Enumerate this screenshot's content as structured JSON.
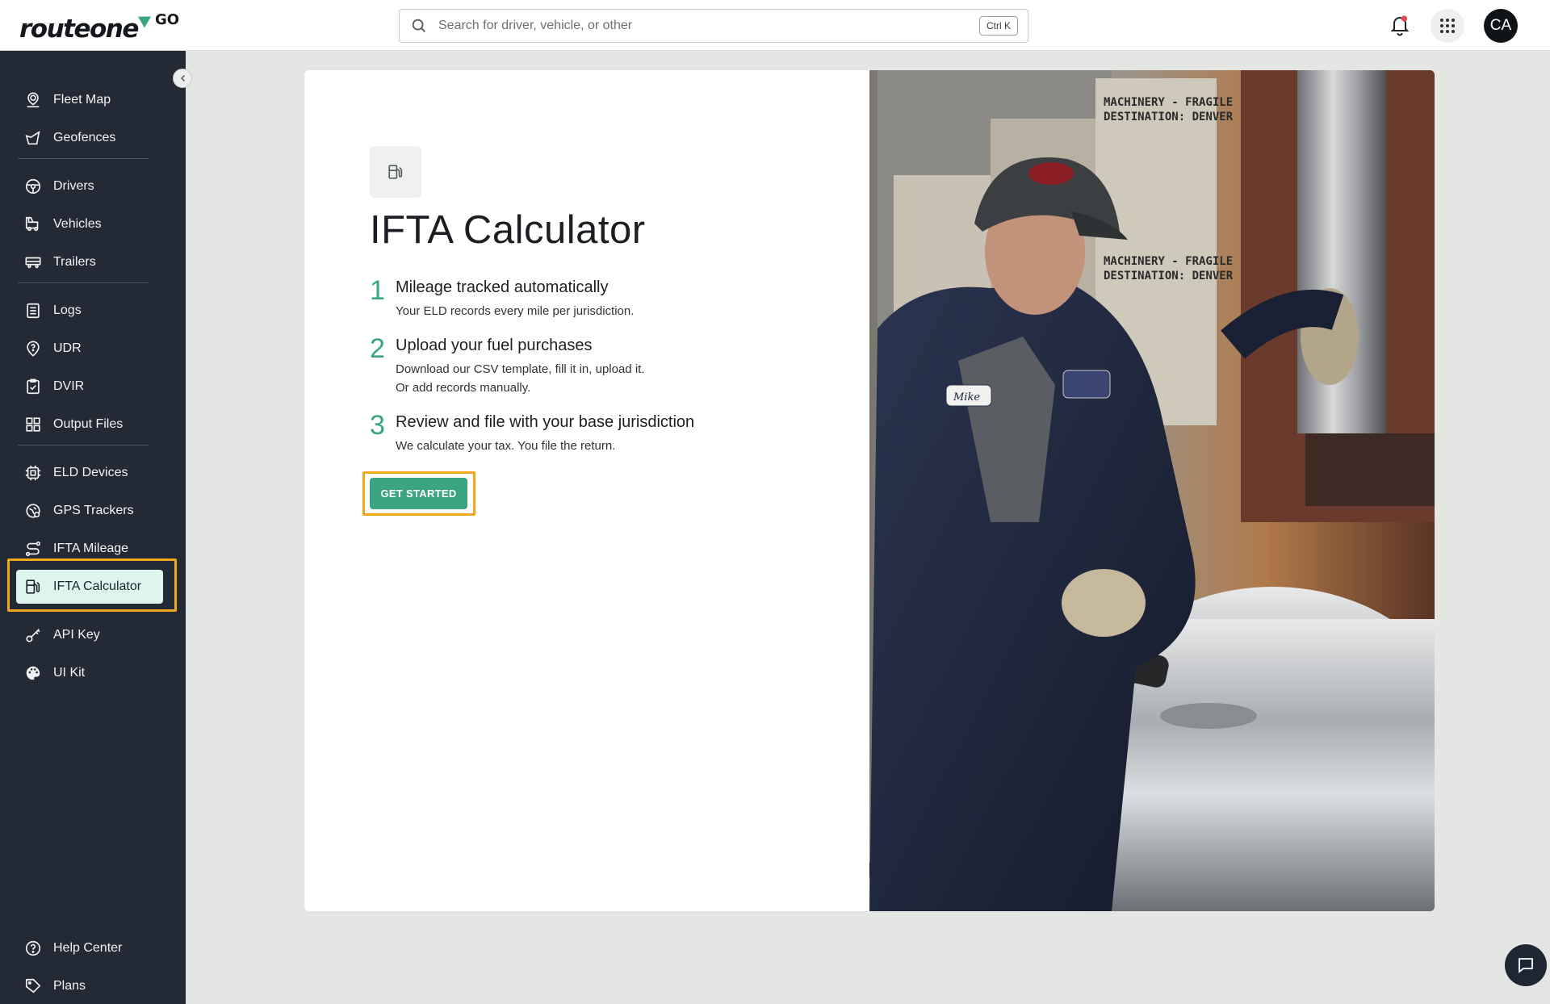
{
  "brand": {
    "name": "routeone",
    "suffix": "GO"
  },
  "search": {
    "placeholder": "Search for driver, vehicle, or other",
    "shortcut": "Ctrl K"
  },
  "user": {
    "initials": "CA"
  },
  "sidebar": {
    "items": [
      {
        "label": "Fleet Map",
        "icon": "map-pin-icon"
      },
      {
        "label": "Geofences",
        "icon": "geofence-icon"
      },
      {
        "label": "Drivers",
        "icon": "steering-wheel-icon"
      },
      {
        "label": "Vehicles",
        "icon": "truck-icon"
      },
      {
        "label": "Trailers",
        "icon": "trailer-icon"
      },
      {
        "label": "Logs",
        "icon": "logs-icon"
      },
      {
        "label": "UDR",
        "icon": "udr-icon"
      },
      {
        "label": "DVIR",
        "icon": "checklist-icon"
      },
      {
        "label": "Output Files",
        "icon": "grid-icon"
      },
      {
        "label": "ELD Devices",
        "icon": "device-icon"
      },
      {
        "label": "GPS Trackers",
        "icon": "gps-icon"
      },
      {
        "label": "IFTA Mileage",
        "icon": "route-icon"
      },
      {
        "label": "IFTA Calculator",
        "icon": "fuel-pump-icon",
        "active": true
      },
      {
        "label": "API Key",
        "icon": "key-icon"
      },
      {
        "label": "UI Kit",
        "icon": "palette-icon"
      }
    ],
    "footer": [
      {
        "label": "Help Center",
        "icon": "help-icon"
      },
      {
        "label": "Plans",
        "icon": "tag-icon"
      }
    ]
  },
  "main": {
    "title": "IFTA Calculator",
    "steps": [
      {
        "num": "1",
        "title": "Mileage tracked automatically",
        "desc": [
          "Your ELD records every mile per jurisdiction."
        ]
      },
      {
        "num": "2",
        "title": "Upload your fuel purchases",
        "desc": [
          "Download our CSV template, fill it in, upload it.",
          "Or add records manually."
        ]
      },
      {
        "num": "3",
        "title": "Review and file with your base jurisdiction",
        "desc": [
          "We calculate your tax. You file the return."
        ]
      }
    ],
    "cta_label": "GET STARTED",
    "photo": {
      "sign_lines": [
        "MACHINERY - FRAGILE",
        "DESTINATION: DENVER"
      ],
      "name_patch": "Mike"
    }
  },
  "colors": {
    "sidebar_bg": "#242a35",
    "accent": "#3aa57f",
    "highlight": "#f4a51c",
    "active_item_bg": "#def5ee",
    "page_bg": "#e3e6e3"
  }
}
